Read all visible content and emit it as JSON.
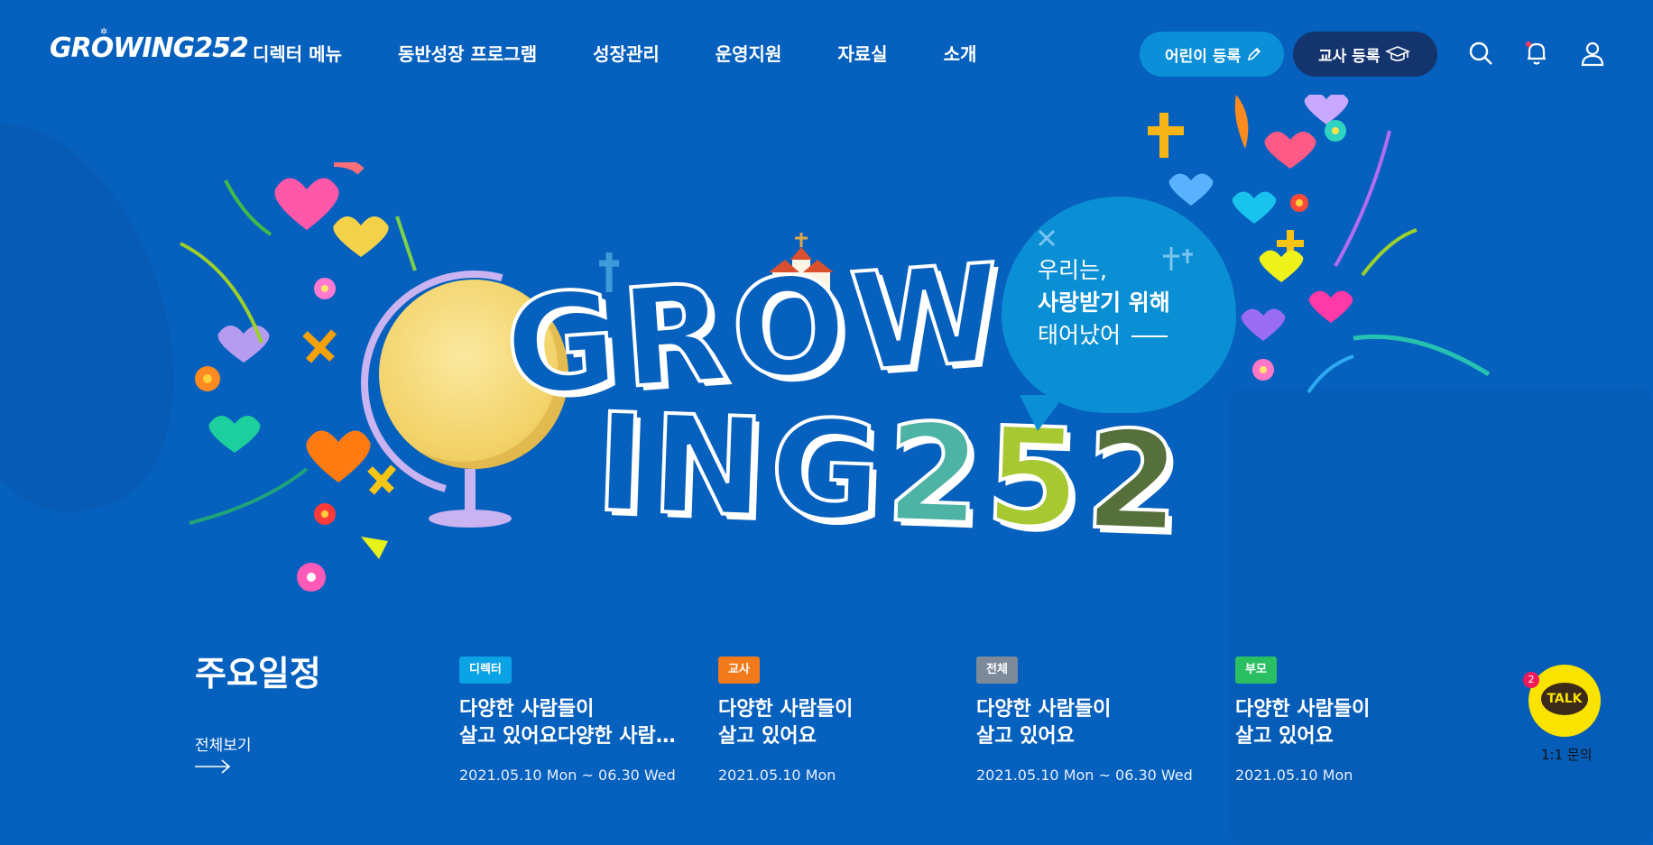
{
  "header": {
    "logo": "GROWING252",
    "nav": [
      "디렉터 메뉴",
      "동반성장 프로그램",
      "성장관리",
      "운영지원",
      "자료실",
      "소개"
    ],
    "child_register": "어린이 등록",
    "teacher_register": "교사 등록",
    "icons": [
      "search-icon",
      "bell-icon",
      "user-icon"
    ]
  },
  "hero": {
    "title_line1": "GROW",
    "title_line2_letters": "ING",
    "title_line2_digits": [
      "2",
      "5",
      "2"
    ],
    "bubble_line1": "우리는,",
    "bubble_line2": "사랑받기 위해",
    "bubble_line3": "태어났어"
  },
  "schedule": {
    "title": "주요일정",
    "view_all": "전체보기",
    "cards": [
      {
        "badge": "디렉터",
        "badge_color": "#0ba3e5",
        "line1": "다양한 사람들이",
        "line2": "살고 있어요다양한 사람...",
        "date": "2021.05.10 Mon ~ 06.30 Wed"
      },
      {
        "badge": "교사",
        "badge_color": "#f27a1a",
        "line1": "다양한 사람들이",
        "line2": "살고 있어요",
        "date": "2021.05.10 Mon"
      },
      {
        "badge": "전체",
        "badge_color": "#7d8a9a",
        "line1": "다양한 사람들이",
        "line2": "살고 있어요",
        "date": "2021.05.10 Mon ~ 06.30 Wed"
      },
      {
        "badge": "부모",
        "badge_color": "#2bbf63",
        "line1": "다양한 사람들이",
        "line2": "살고 있어요",
        "date": "2021.05.10 Mon"
      }
    ]
  },
  "talk": {
    "label": "TALK",
    "badge_count": "2",
    "caption": "1:1 문의"
  },
  "colors": {
    "background": "#0660bd",
    "accent_child": "#0b8fd8",
    "accent_teacher": "#14346e",
    "kakao_yellow": "#fbe300"
  }
}
